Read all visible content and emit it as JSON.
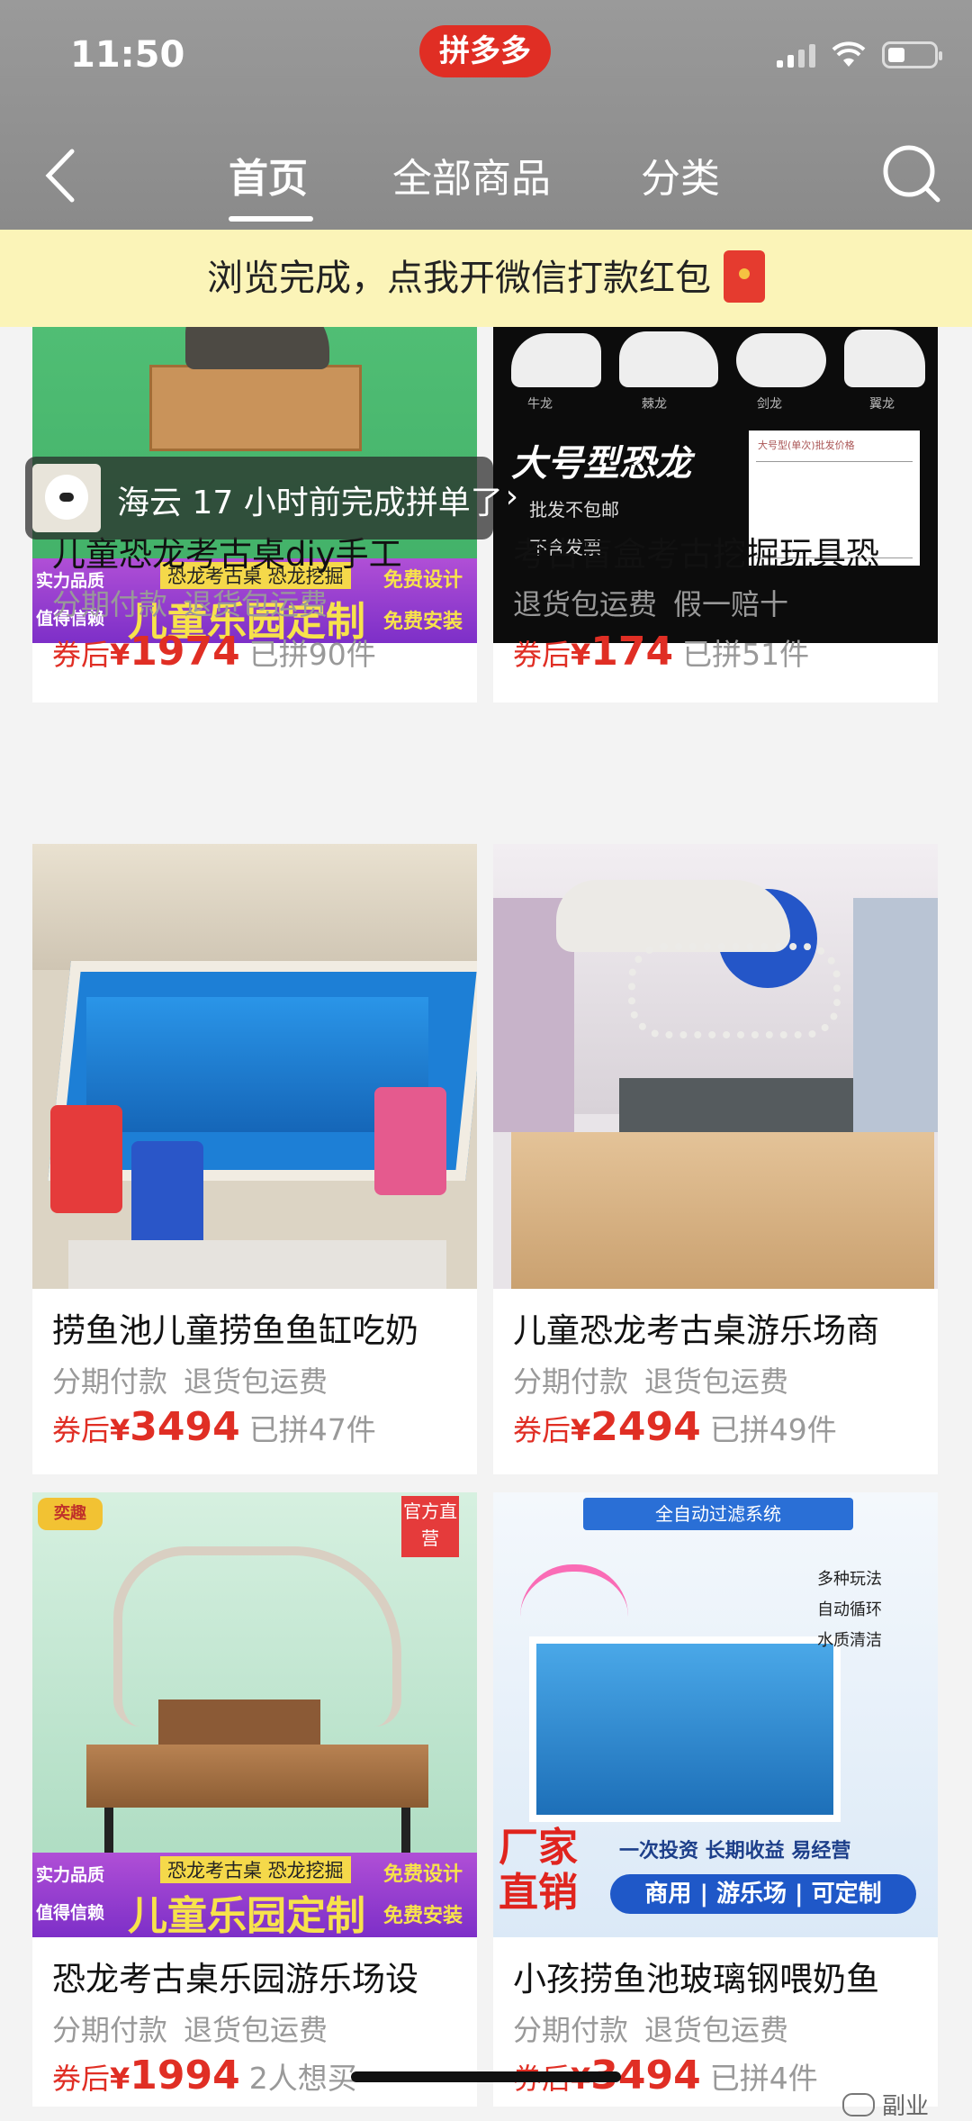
{
  "status_bar": {
    "time": "11:50"
  },
  "brand": {
    "label": "拼多多"
  },
  "nav": {
    "tabs": [
      {
        "label": "首页",
        "active": true
      },
      {
        "label": "全部商品",
        "active": false
      },
      {
        "label": "分类",
        "active": false
      }
    ]
  },
  "banner": {
    "text": "浏览完成，点我开微信打款红包"
  },
  "notification": {
    "text": "海云 17 小时前完成拼单了"
  },
  "products": [
    {
      "title": "儿童恐龙考古桌diy手工",
      "tags": [
        "分期付款",
        "退货包运费"
      ],
      "coupon": "券后",
      "currency": "¥",
      "price": "1974",
      "sold": "已拼90件",
      "image": {
        "strip_left_1": "实力品质",
        "strip_left_2": "值得信赖",
        "strip_top": "恐龙考古桌 恐龙挖掘",
        "strip_main": "儿童乐园定制",
        "strip_right_1": "免费设计",
        "strip_right_2": "免费安装"
      }
    },
    {
      "title": "考古盲盒考古挖掘玩具恐",
      "tags": [
        "退货包运费",
        "假一赔十"
      ],
      "coupon": "券后",
      "currency": "¥",
      "price": "174",
      "sold": "已拼51件",
      "image": {
        "headline": "大号型恐龙",
        "note1": "批发不包邮",
        "note2": "不含发票",
        "labels": [
          "牛龙",
          "棘龙",
          "剑龙",
          "翼龙"
        ],
        "table_title": "大号型(单次)批发价格"
      }
    },
    {
      "title": "捞鱼池儿童捞鱼鱼缸吃奶",
      "tags": [
        "分期付款",
        "退货包运费"
      ],
      "coupon": "券后",
      "currency": "¥",
      "price": "3494",
      "sold": "已拼47件"
    },
    {
      "title": "儿童恐龙考古桌游乐场商",
      "tags": [
        "分期付款",
        "退货包运费"
      ],
      "coupon": "券后",
      "currency": "¥",
      "price": "2494",
      "sold": "已拼49件"
    },
    {
      "title": "恐龙考古桌乐园游乐场设",
      "tags": [
        "分期付款",
        "退货包运费"
      ],
      "coupon": "券后",
      "currency": "¥",
      "price": "1994",
      "sold": "2人想买",
      "image": {
        "badge": "官方直营",
        "logo": "奕趣",
        "strip_left_1": "实力品质",
        "strip_left_2": "值得信赖",
        "strip_top": "恐龙考古桌 恐龙挖掘",
        "strip_main": "儿童乐园定制",
        "strip_right_1": "免费设计",
        "strip_right_2": "免费安装"
      }
    },
    {
      "title": "小孩捞鱼池玻璃钢喂奶鱼",
      "tags": [
        "分期付款",
        "退货包运费"
      ],
      "coupon": "券后",
      "currency": "¥",
      "price": "3494",
      "sold": "已拼4件",
      "image": {
        "top": "全自动过滤系统",
        "checks": [
          "多种玩法",
          "自动循环",
          "水质清洁"
        ],
        "big1": "厂家",
        "big2": "直销",
        "slogan": "一次投资 长期收益 易经营",
        "bottom": "商用 | 游乐场 | 可定制"
      }
    }
  ],
  "watermark": {
    "text": "副业"
  },
  "colors": {
    "accent": "#e02e24",
    "banner_bg": "#fbf4b8",
    "header_bg": "#8f8f8f"
  }
}
